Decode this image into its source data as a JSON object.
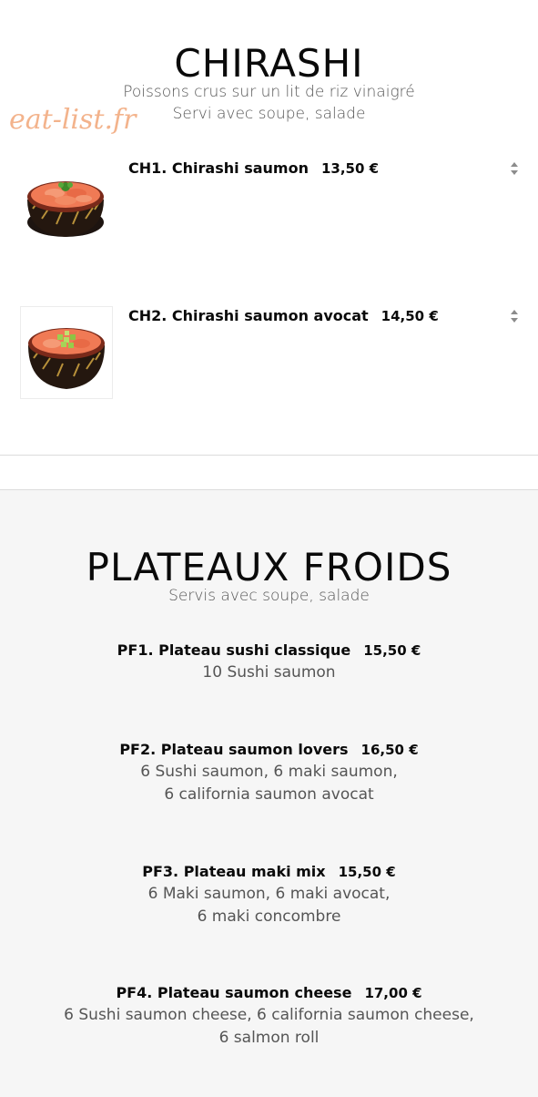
{
  "watermark": "eat-list.fr",
  "chirashi": {
    "title": "CHIRASHI",
    "subtitle_line1": "Poissons crus sur un lit de riz vinaigré",
    "subtitle_line2": "Servi avec soupe, salade",
    "items": [
      {
        "name": "CH1. Chirashi saumon",
        "price": "13,50 €",
        "icon": "sort-icon"
      },
      {
        "name": "CH2. Chirashi saumon avocat",
        "price": "14,50 €",
        "icon": "sort-icon"
      }
    ]
  },
  "plateaux": {
    "title": "PLATEAUX FROIDS",
    "subtitle": "Servis avec soupe, salade",
    "items": [
      {
        "name": "PF1. Plateau sushi classique",
        "price": "15,50 €",
        "desc_line1": "10 Sushi saumon",
        "desc_line2": ""
      },
      {
        "name": "PF2. Plateau saumon lovers",
        "price": "16,50 €",
        "desc_line1": "6 Sushi saumon, 6 maki saumon,",
        "desc_line2": "6 california saumon avocat"
      },
      {
        "name": "PF3. Plateau maki mix",
        "price": "15,50 €",
        "desc_line1": "6 Maki saumon, 6 maki avocat,",
        "desc_line2": "6 maki concombre"
      },
      {
        "name": "PF4. Plateau saumon cheese",
        "price": "17,00 €",
        "desc_line1": "6 Sushi saumon cheese, 6 california saumon cheese,",
        "desc_line2": "6 salmon roll"
      }
    ]
  },
  "colors": {
    "watermark": "#f3b38c",
    "grey_section": "#f6f6f6",
    "text": "#0a0a0a",
    "muted": "#555555"
  }
}
